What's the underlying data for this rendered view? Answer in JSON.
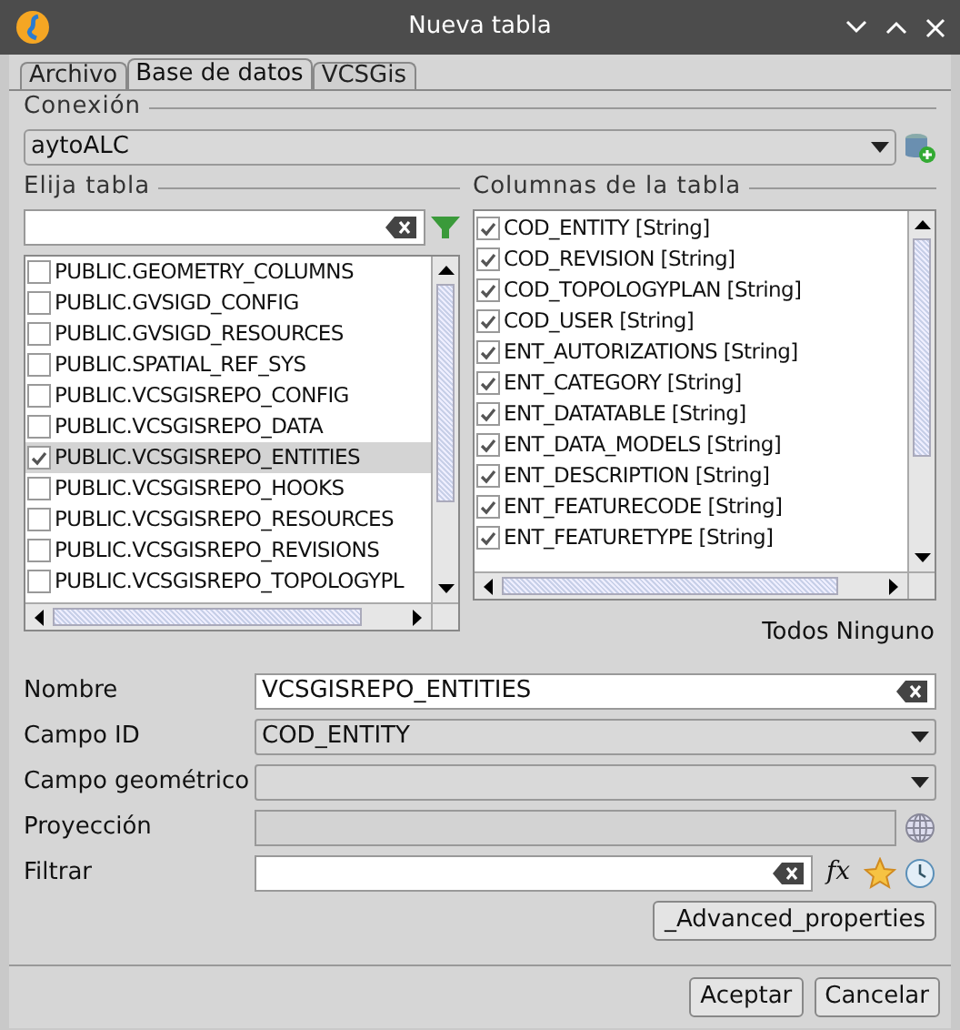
{
  "window": {
    "title": "Nueva tabla"
  },
  "tabs": [
    {
      "label": "Archivo",
      "selected": false
    },
    {
      "label": "Base de datos",
      "selected": true
    },
    {
      "label": "VCSGis",
      "selected": false
    }
  ],
  "connection": {
    "heading": "Conexión",
    "value": "aytoALC"
  },
  "tables": {
    "heading": "Elija tabla",
    "items": [
      {
        "label": "PUBLIC.GEOMETRY_COLUMNS",
        "checked": false,
        "selected": false
      },
      {
        "label": "PUBLIC.GVSIGD_CONFIG",
        "checked": false,
        "selected": false
      },
      {
        "label": "PUBLIC.GVSIGD_RESOURCES",
        "checked": false,
        "selected": false
      },
      {
        "label": "PUBLIC.SPATIAL_REF_SYS",
        "checked": false,
        "selected": false
      },
      {
        "label": "PUBLIC.VCSGISREPO_CONFIG",
        "checked": false,
        "selected": false
      },
      {
        "label": "PUBLIC.VCSGISREPO_DATA",
        "checked": false,
        "selected": false
      },
      {
        "label": "PUBLIC.VCSGISREPO_ENTITIES",
        "checked": true,
        "selected": true
      },
      {
        "label": "PUBLIC.VCSGISREPO_HOOKS",
        "checked": false,
        "selected": false
      },
      {
        "label": "PUBLIC.VCSGISREPO_RESOURCES",
        "checked": false,
        "selected": false
      },
      {
        "label": "PUBLIC.VCSGISREPO_REVISIONS",
        "checked": false,
        "selected": false
      },
      {
        "label": "PUBLIC.VCSGISREPO_TOPOLOGYPL",
        "checked": false,
        "selected": false
      }
    ]
  },
  "columns": {
    "heading": "Columnas de la tabla",
    "items": [
      {
        "label": "COD_ENTITY [String]",
        "checked": true
      },
      {
        "label": "COD_REVISION [String]",
        "checked": true
      },
      {
        "label": "COD_TOPOLOGYPLAN [String]",
        "checked": true
      },
      {
        "label": "COD_USER [String]",
        "checked": true
      },
      {
        "label": "ENT_AUTORIZATIONS [String]",
        "checked": true
      },
      {
        "label": "ENT_CATEGORY [String]",
        "checked": true
      },
      {
        "label": "ENT_DATATABLE [String]",
        "checked": true
      },
      {
        "label": "ENT_DATA_MODELS [String]",
        "checked": true
      },
      {
        "label": "ENT_DESCRIPTION [String]",
        "checked": true
      },
      {
        "label": "ENT_FEATURECODE [String]",
        "checked": true
      },
      {
        "label": "ENT_FEATURETYPE [String]",
        "checked": true
      }
    ],
    "buttons": [
      "Todos",
      "Ninguno"
    ]
  },
  "form": {
    "fields": [
      {
        "label": "Nombre",
        "kind": "text",
        "value": "VCSGISREPO_ENTITIES"
      },
      {
        "label": "Campo ID",
        "kind": "combo",
        "value": "COD_ENTITY"
      },
      {
        "label": "Campo geométrico",
        "kind": "combo"
      },
      {
        "label": "Proyección",
        "kind": "readonly"
      },
      {
        "label": "Filtrar",
        "kind": "filter",
        "expression_button": "fx"
      }
    ],
    "advanced_button": "_Advanced_properties"
  },
  "buttons": [
    "Aceptar",
    "Cancelar"
  ]
}
